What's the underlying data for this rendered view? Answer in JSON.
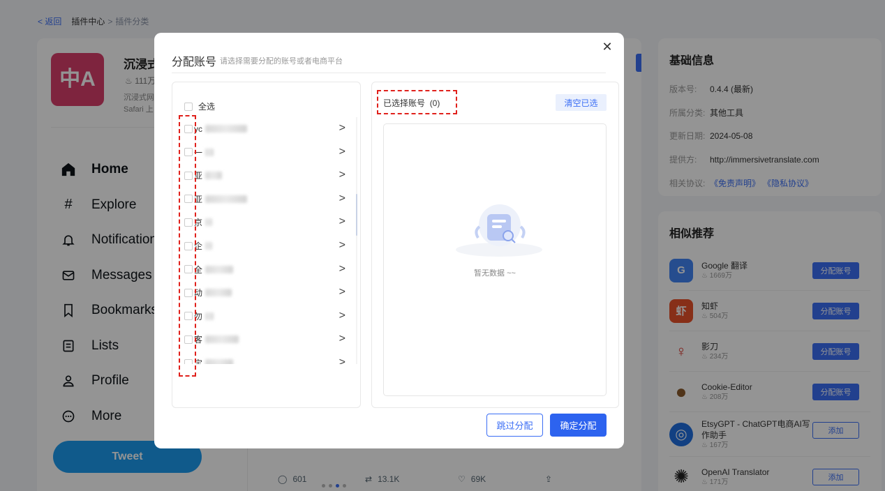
{
  "breadcrumb": {
    "back": "返回",
    "items": [
      "插件中心",
      "插件分类"
    ],
    "sep": ">"
  },
  "plugin": {
    "logo_text": "中A",
    "title": "沉浸式",
    "hot": "111万",
    "desc": [
      "沉浸式网",
      "Safari 上"
    ]
  },
  "twitter_nav": {
    "items": [
      {
        "label": "Home",
        "icon": "home-icon"
      },
      {
        "label": "Explore",
        "icon": "hashtag-icon"
      },
      {
        "label": "Notifications",
        "icon": "bell-icon"
      },
      {
        "label": "Messages",
        "icon": "mail-icon"
      },
      {
        "label": "Bookmarks",
        "icon": "bookmark-icon"
      },
      {
        "label": "Lists",
        "icon": "list-icon"
      },
      {
        "label": "Profile",
        "icon": "profile-icon"
      },
      {
        "label": "More",
        "icon": "more-icon"
      }
    ],
    "tweet_button": "Tweet"
  },
  "tweet_actions": {
    "replies": "601",
    "retweets": "13.1K",
    "likes": "69K"
  },
  "info": {
    "heading": "基础信息",
    "rows": [
      {
        "k": "版本号:",
        "v": "0.4.4 (最新)"
      },
      {
        "k": "所属分类:",
        "v": "其他工具"
      },
      {
        "k": "更新日期:",
        "v": "2024-05-08"
      },
      {
        "k": "提供方:",
        "v": "http://immersivetranslate.com"
      }
    ],
    "agreement_label": "相关协议:",
    "agreement_links": [
      "《免责声明》",
      "《隐私协议》"
    ]
  },
  "similar": {
    "heading": "相似推荐",
    "items": [
      {
        "name": "Google 翻译",
        "hot": "1669万",
        "btn": "分配账号",
        "color": "#4285f4",
        "glyph": "G"
      },
      {
        "name": "知虾",
        "hot": "504万",
        "btn": "分配账号",
        "color": "#e8522a",
        "glyph": "虾"
      },
      {
        "name": "影刀",
        "hot": "234万",
        "btn": "分配账号",
        "color": "#ffffff",
        "glyph": "♀"
      },
      {
        "name": "Cookie-Editor",
        "hot": "208万",
        "btn": "分配账号",
        "color": "#ffffff",
        "glyph": "●"
      },
      {
        "name": "EtsyGPT - ChatGPT电商AI写作助手",
        "hot": "167万",
        "btn": "添加",
        "color": "#1f6fe0",
        "glyph": "◎"
      },
      {
        "name": "OpenAI Translator",
        "hot": "171万",
        "btn": "添加",
        "color": "#ffffff",
        "glyph": "✺"
      }
    ]
  },
  "modal": {
    "title": "分配账号",
    "subtitle": "请选择需要分配的账号或者电商平台",
    "select_all": "全选",
    "accounts": [
      {
        "label": "yc"
      },
      {
        "label": "一"
      },
      {
        "label": "亚"
      },
      {
        "label": "亚"
      },
      {
        "label": "京"
      },
      {
        "label": "企"
      },
      {
        "label": "全"
      },
      {
        "label": "动"
      },
      {
        "label": "勿"
      },
      {
        "label": "客"
      },
      {
        "label": "宝"
      }
    ],
    "selected_label": "已选择账号",
    "selected_count": "(0)",
    "clear_button": "清空已选",
    "empty_text": "暂无数据 ~~",
    "skip_button": "跳过分配",
    "confirm_button": "确定分配",
    "accent_color": "#3b6ef5",
    "highlight_color": "#e0201b"
  }
}
